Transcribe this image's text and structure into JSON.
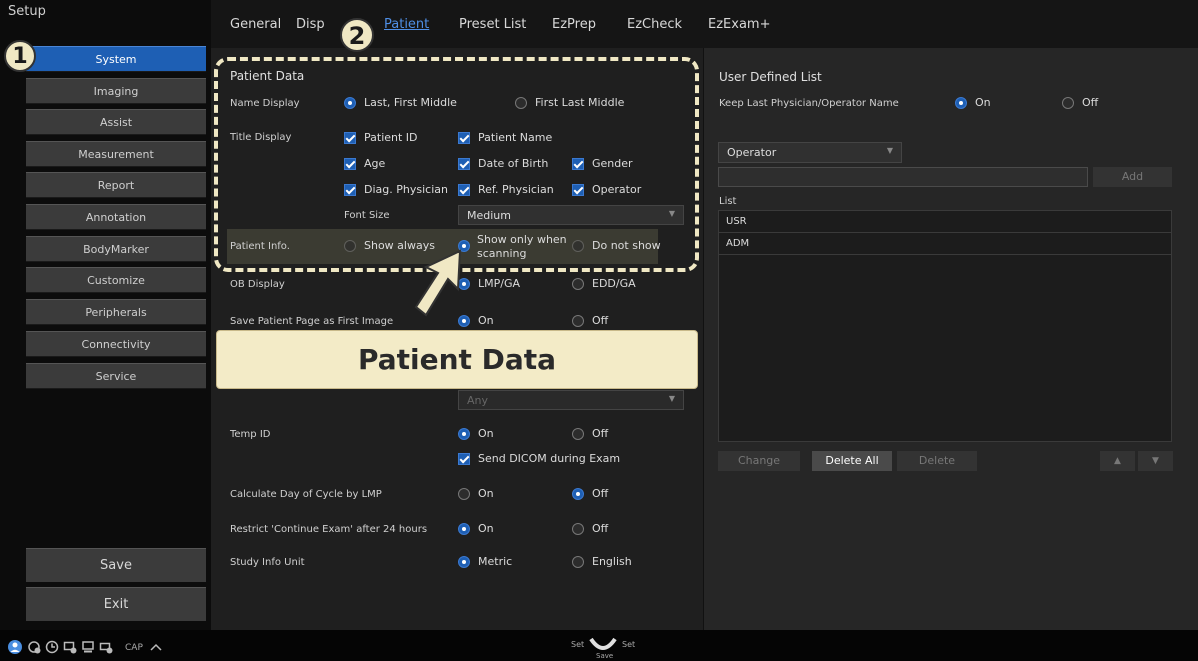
{
  "setup_title": "Setup",
  "sidebar": {
    "items": [
      {
        "label": "System"
      },
      {
        "label": "Imaging"
      },
      {
        "label": "Assist"
      },
      {
        "label": "Measurement"
      },
      {
        "label": "Report"
      },
      {
        "label": "Annotation"
      },
      {
        "label": "BodyMarker"
      },
      {
        "label": "Customize"
      },
      {
        "label": "Peripherals"
      },
      {
        "label": "Connectivity"
      },
      {
        "label": "Service"
      }
    ],
    "save_label": "Save",
    "exit_label": "Exit"
  },
  "tabs": [
    "General",
    "Disp",
    "Patient",
    "Preset List",
    "EzPrep",
    "EzCheck",
    "EzExam+"
  ],
  "badges": {
    "one": "1",
    "two": "2"
  },
  "patient_data": {
    "section_title": "Patient Data",
    "name_display": {
      "label": "Name Display",
      "opt1": "Last, First Middle",
      "opt2": "First Last Middle"
    },
    "title_display": {
      "label": "Title Display",
      "patient_id": "Patient ID",
      "patient_name": "Patient Name",
      "age": "Age",
      "dob": "Date of Birth",
      "gender": "Gender",
      "diag_physician": "Diag. Physician",
      "ref_physician": "Ref. Physician",
      "operator": "Operator"
    },
    "font_size": {
      "label": "Font Size",
      "value": "Medium"
    },
    "patient_info": {
      "label": "Patient Info.",
      "opt1": "Show always",
      "opt2_line1": "Show only when",
      "opt2_line2": "scanning",
      "opt3": "Do not show"
    }
  },
  "ob_display": {
    "label": "OB Display",
    "opt1": "LMP/GA",
    "opt2": "EDD/GA"
  },
  "save_first_image": {
    "label": "Save Patient Page as First Image",
    "on": "On",
    "off": "Off"
  },
  "banner": "Patient Data",
  "any_select": "Any",
  "temp_id": {
    "label": "Temp ID",
    "on": "On",
    "off": "Off",
    "send_dicom": "Send DICOM during Exam"
  },
  "calc_day": {
    "label": "Calculate Day of Cycle by LMP",
    "on": "On",
    "off": "Off"
  },
  "restrict": {
    "label": "Restrict 'Continue Exam' after 24 hours",
    "on": "On",
    "off": "Off"
  },
  "study_unit": {
    "label": "Study Info Unit",
    "metric": "Metric",
    "english": "English"
  },
  "user_list": {
    "title": "User Defined List",
    "keep_label": "Keep Last Physician/Operator Name",
    "on": "On",
    "off": "Off",
    "dropdown_value": "Operator",
    "add_label": "Add",
    "list_label": "List",
    "items": [
      "USR",
      "ADM"
    ],
    "change_label": "Change",
    "delete_all_label": "Delete All",
    "delete_label": "Delete",
    "up_arrow": "▲",
    "down_arrow": "▼"
  },
  "status": {
    "cap": "CAP",
    "set_left": "Set",
    "set_right": "Set",
    "save": "Save"
  }
}
